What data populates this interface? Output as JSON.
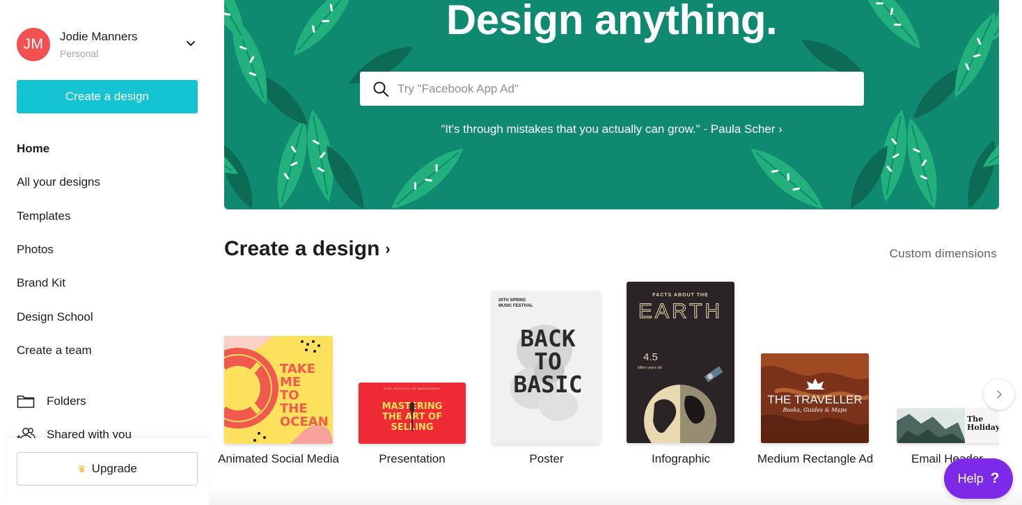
{
  "user": {
    "initials": "JM",
    "name": "Jodie Manners",
    "plan": "Personal"
  },
  "sidebar": {
    "create_label": "Create a design",
    "items": [
      {
        "label": "Home",
        "active": true
      },
      {
        "label": "All your designs"
      },
      {
        "label": "Templates"
      },
      {
        "label": "Photos"
      },
      {
        "label": "Brand Kit"
      },
      {
        "label": "Design School"
      },
      {
        "label": "Create a team"
      }
    ],
    "folders_label": "Folders",
    "shared_label": "Shared with you",
    "upgrade_label": "Upgrade"
  },
  "hero": {
    "title": "Design anything.",
    "search_placeholder": "Try \"Facebook App Ad\"",
    "quote": "\"It's through mistakes that you actually can grow.\" - Paula Scher ›"
  },
  "section": {
    "title": "Create a design",
    "chevron": "›",
    "custom_dimensions": "Custom dimensions"
  },
  "cards": [
    {
      "label": "Animated Social Media",
      "thumb_text": "TAKE ME TO THE OCEAN"
    },
    {
      "label": "Presentation",
      "thumb_top": "ATHE INSTITUTE OF MANAGEMENT",
      "thumb_text": "MASTERING THE ART OF SELLING"
    },
    {
      "label": "Poster",
      "thumb_top": "20TH SPRING MUSIC FESTIVAL",
      "thumb_text": "BACK TO BASIC"
    },
    {
      "label": "Infographic",
      "thumb_top": "FACTS ABOUT THE",
      "thumb_text": "EARTH",
      "thumb_value": "4.5",
      "thumb_sub": "billion years old"
    },
    {
      "label": "Medium Rectangle Ad",
      "thumb_text": "THE TRAVELLER",
      "thumb_sub": "Books, Guides & Maps"
    },
    {
      "label": "Email Header",
      "thumb_text": "The Holiday"
    }
  ],
  "help": {
    "label": "Help",
    "symbol": "?"
  },
  "colors": {
    "accent": "#14c4d2",
    "hero_bg": "#0f8a71",
    "help_bg": "#7d2ae8",
    "avatar_bg": "#f25151"
  }
}
